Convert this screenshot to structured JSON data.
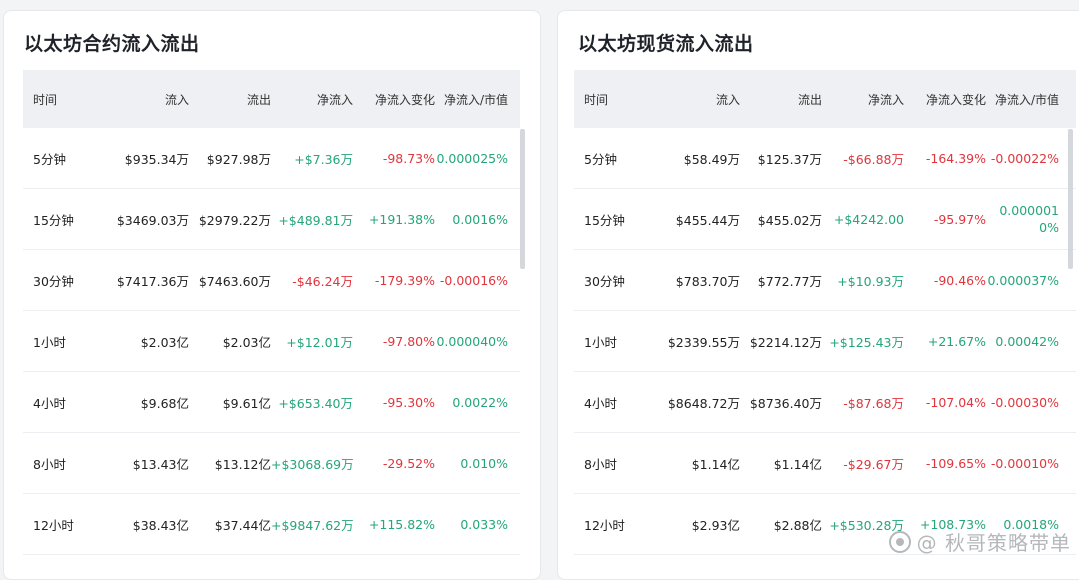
{
  "colors": {
    "positive": "#24a57a",
    "negative": "#e0353d",
    "header_bg": "#eef0f3"
  },
  "left": {
    "title": "以太坊合约流入流出",
    "headers": [
      "时间",
      "流入",
      "流出",
      "净流入",
      "净流入变化",
      "净流入/市值"
    ],
    "rows": [
      {
        "time": "5分钟",
        "inflow": "$935.34万",
        "outflow": "$927.98万",
        "net": "+$7.36万",
        "change": "-98.73%",
        "ratio": "0.000025%"
      },
      {
        "time": "15分钟",
        "inflow": "$3469.03万",
        "outflow": "$2979.22万",
        "net": "+$489.81万",
        "change": "+191.38%",
        "ratio": "0.0016%"
      },
      {
        "time": "30分钟",
        "inflow": "$7417.36万",
        "outflow": "$7463.60万",
        "net": "-$46.24万",
        "change": "-179.39%",
        "ratio": "-0.00016%"
      },
      {
        "time": "1小时",
        "inflow": "$2.03亿",
        "outflow": "$2.03亿",
        "net": "+$12.01万",
        "change": "-97.80%",
        "ratio": "0.000040%"
      },
      {
        "time": "4小时",
        "inflow": "$9.68亿",
        "outflow": "$9.61亿",
        "net": "+$653.40万",
        "change": "-95.30%",
        "ratio": "0.0022%"
      },
      {
        "time": "8小时",
        "inflow": "$13.43亿",
        "outflow": "$13.12亿",
        "net": "+$3068.69万",
        "change": "-29.52%",
        "ratio": "0.010%"
      },
      {
        "time": "12小时",
        "inflow": "$38.43亿",
        "outflow": "$37.44亿",
        "net": "+$9847.62万",
        "change": "+115.82%",
        "ratio": "0.033%"
      }
    ]
  },
  "right": {
    "title": "以太坊现货流入流出",
    "headers": [
      "时间",
      "流入",
      "流出",
      "净流入",
      "净流入变化",
      "净流入/市值"
    ],
    "rows": [
      {
        "time": "5分钟",
        "inflow": "$58.49万",
        "outflow": "$125.37万",
        "net": "-$66.88万",
        "change": "-164.39%",
        "ratio": "-0.00022%"
      },
      {
        "time": "15分钟",
        "inflow": "$455.44万",
        "outflow": "$455.02万",
        "net": "+$4242.00",
        "change": "-95.97%",
        "ratio": "0.0000010%"
      },
      {
        "time": "30分钟",
        "inflow": "$783.70万",
        "outflow": "$772.77万",
        "net": "+$10.93万",
        "change": "-90.46%",
        "ratio": "0.000037%"
      },
      {
        "time": "1小时",
        "inflow": "$2339.55万",
        "outflow": "$2214.12万",
        "net": "+$125.43万",
        "change": "+21.67%",
        "ratio": "0.00042%"
      },
      {
        "time": "4小时",
        "inflow": "$8648.72万",
        "outflow": "$8736.40万",
        "net": "-$87.68万",
        "change": "-107.04%",
        "ratio": "-0.00030%"
      },
      {
        "time": "8小时",
        "inflow": "$1.14亿",
        "outflow": "$1.14亿",
        "net": "-$29.67万",
        "change": "-109.65%",
        "ratio": "-0.00010%"
      },
      {
        "time": "12小时",
        "inflow": "$2.93亿",
        "outflow": "$2.88亿",
        "net": "+$530.28万",
        "change": "+108.73%",
        "ratio": "0.0018%"
      }
    ]
  },
  "watermark": {
    "text": "@ 秋哥策略带单",
    "icon": "wechat-channel-icon"
  }
}
